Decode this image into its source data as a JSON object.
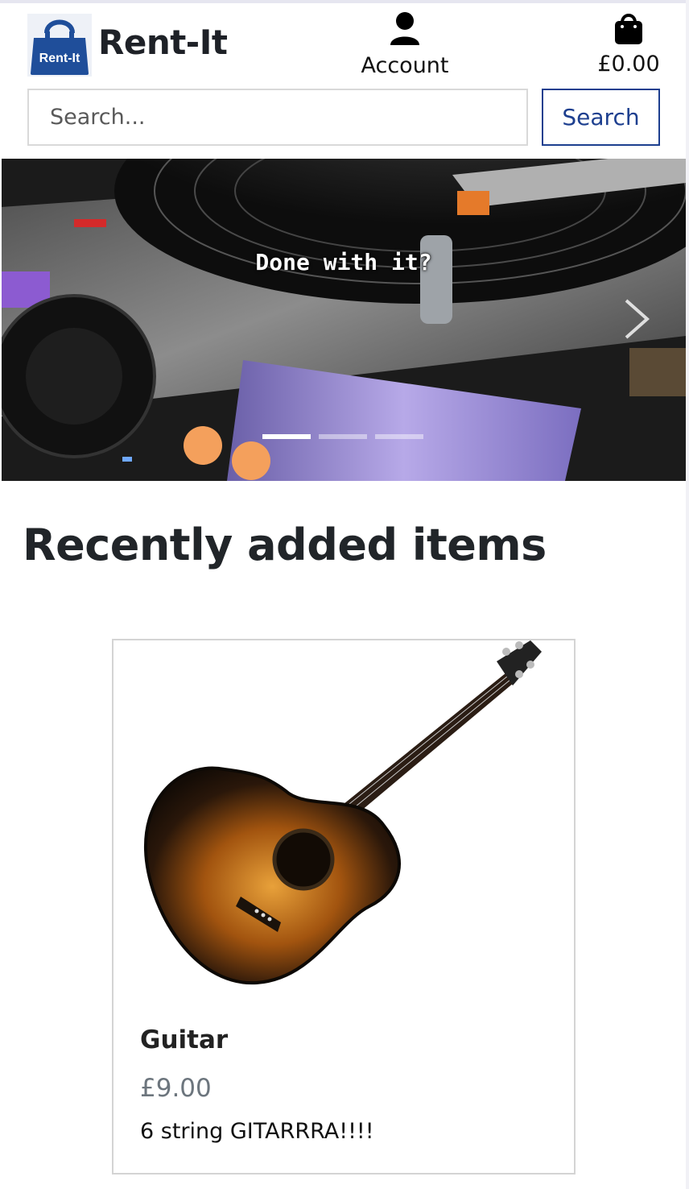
{
  "header": {
    "logo_text": "Rent-It",
    "brand": "Rent-It",
    "account_label": "Account",
    "cart_total": "£0.00"
  },
  "search": {
    "placeholder": "Search...",
    "value": "",
    "button_label": "Search"
  },
  "hero": {
    "caption": "Done with it?",
    "slides": 3,
    "active_slide": 1
  },
  "section": {
    "title": "Recently added items"
  },
  "items": [
    {
      "title": "Guitar",
      "price": "£9.00",
      "description": "6 string GITARRRA!!!!"
    }
  ],
  "colors": {
    "brand_blue": "#1d3f8f",
    "logo_bag": "#1f4e9a",
    "text_dark": "#212529",
    "price_grey": "#6c757d"
  },
  "icons": {
    "account": "person-icon",
    "cart": "shopping-bag-icon",
    "next": "chevron-right-icon"
  }
}
